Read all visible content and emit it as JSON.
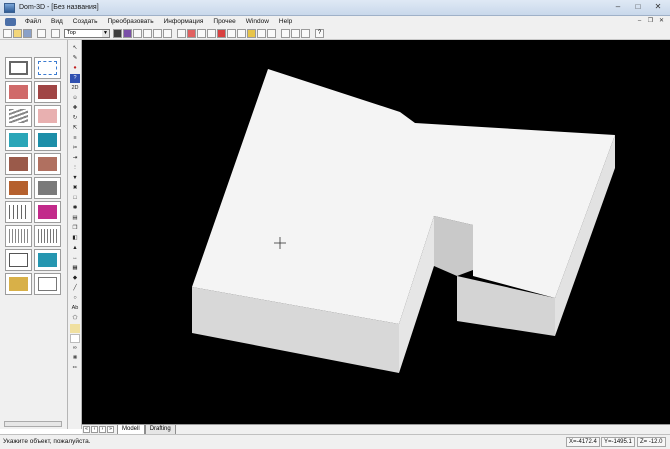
{
  "window": {
    "title": "Dom-3D - [Без названия]"
  },
  "menu": {
    "items": [
      "Файл",
      "Вид",
      "Создать",
      "Преобразовать",
      "Информация",
      "Прочее",
      "Window",
      "Help"
    ]
  },
  "toolbar": {
    "view_select_value": "Top"
  },
  "tabs": {
    "items": [
      "Modell",
      "Drafting"
    ],
    "active": "Modell"
  },
  "status": {
    "message": "Укажите объект, пожалуйста.",
    "x": "X=-4172.4",
    "y": "Y=-1495.1",
    "z": "Z= -12.0"
  },
  "colors": {
    "viewport_bg": "#000000",
    "model_top": "#f4f4f4",
    "model_side": "#dcdcdc"
  },
  "vertical_tool_labels": [
    "2D",
    "Ab"
  ]
}
